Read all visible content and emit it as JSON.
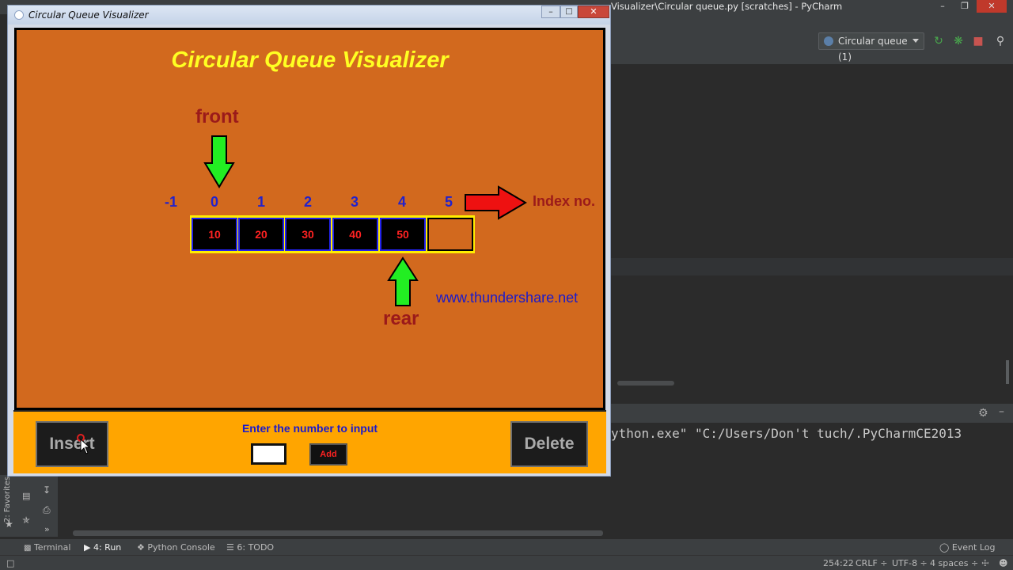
{
  "ide": {
    "title": "Visualizer\\Circular queue.py [scratches] - PyCharm",
    "run_config": "Circular queue (1)",
    "run_output": "ython.exe\" \"C:/Users/Don't tuch/.PyCharmCE2013",
    "favorites_label": "2: Favorites",
    "bottom_tabs": {
      "terminal": "Terminal",
      "run": "4: Run",
      "python_console": "Python Console",
      "todo": "6: TODO",
      "event_log": "Event Log"
    },
    "status": {
      "position": "254:22",
      "line_sep": "CRLF ÷",
      "encoding": "UTF-8 ÷",
      "indent": "4 spaces ÷"
    }
  },
  "visualizer": {
    "window_title": "Circular Queue Visualizer",
    "heading": "Circular Queue Visualizer",
    "front_label": "front",
    "rear_label": "rear",
    "index_label": "Index no.",
    "website": "www.thundershare.net",
    "indices": [
      "-1",
      "0",
      "1",
      "2",
      "3",
      "4",
      "5"
    ],
    "cells": [
      "10",
      "20",
      "30",
      "40",
      "50",
      ""
    ],
    "front_index": 0,
    "rear_index": 4,
    "prompt": "Enter the number to input",
    "input_value": "",
    "add_label": "Add",
    "insert_label": "Insert",
    "delete_label": "Delete"
  },
  "colors": {
    "canvas_bg": "#d2691e",
    "panel_bg": "#ffa500",
    "heading": "#ffff22",
    "label_dark_red": "#9b1a1a",
    "index_blue": "#2222cc",
    "cell_border": "#2222ee",
    "cell_text": "#ff2222",
    "arrow_green": "#22ee22",
    "arrow_red": "#ee1111"
  },
  "icons": {
    "front_arrow": "arrow-down-icon",
    "rear_arrow": "arrow-up-icon",
    "index_arrow": "arrow-right-icon"
  }
}
